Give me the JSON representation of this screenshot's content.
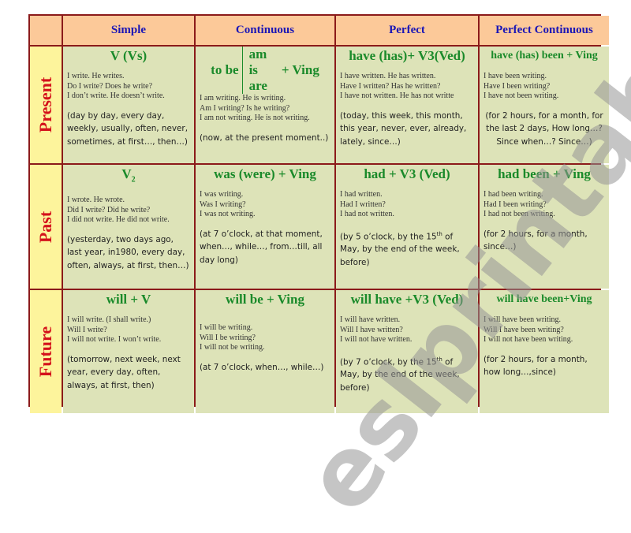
{
  "headers": [
    "Simple",
    "Continuous",
    "Perfect",
    "Perfect Continuous"
  ],
  "rows": [
    {
      "label": "Present",
      "cells": [
        {
          "formula": "V (Vs)",
          "examples": "I write. He writes.\nDo I write? Does he write?\nI don’t write. He doesn’t write.",
          "markers": "(day by day, every day, weekly, usually, often, never, sometimes, at first…, then…)"
        },
        {
          "formula_prefix": "to be",
          "formula_options": [
            "am",
            "is",
            "are"
          ],
          "formula_suffix": "+ Ving",
          "examples": "I am writing. He is writing.\nAm I writing? Is he writing?\nI am not writing. He is not writing.",
          "markers": "(now, at the present moment..)"
        },
        {
          "formula": "have (has)+ V3(Ved)",
          "examples": "I have written. He has written.\nHave I written? Has he written?\nI have not written. He has not writte",
          "markers": "(today, this week, this month, this year, never, ever, already, lately, since…)"
        },
        {
          "formula": "have (has) been + Ving",
          "examples": "I have been writing.\n  Have I been writing?\n  I have not been writing.",
          "markers": "(for 2 hours, for a month, for the last 2 days, How long…? Since when…? Since…)"
        }
      ]
    },
    {
      "label": "Past",
      "cells": [
        {
          "formula": "V2",
          "examples": "I wrote. He wrote.\nDid I write? Did he write?\nI did not write. He did not write.",
          "markers": "(yesterday, two days ago, last year, in1980, every day, often, always, at first, then…)"
        },
        {
          "formula": "was (were) + Ving",
          "examples": "I was writing.\nWas I writing?\nI was not writing.",
          "markers": "(at 7 o’clock, at that moment, when…, while…, from…till, all day long)"
        },
        {
          "formula": "had + V3 (Ved)",
          "examples": "I had written.\nHad I written?\nI had not written.",
          "markers_pre": "(by 5 o’clock, by the 15",
          "markers_sup": "th",
          "markers_post": " of May, by the end of the week, before)"
        },
        {
          "formula": "had been + Ving",
          "examples": "I had been writing.\nHad I been writing?\nI had not been writing.",
          "markers": "(for 2 hours, for a month, since…)"
        }
      ]
    },
    {
      "label": "Future",
      "cells": [
        {
          "formula": "will + V",
          "examples": "I will write. (I shall write.)\nWill I write?\nI will not write. I won’t write.",
          "markers": "(tomorrow, next week, next year, every day, often, always, at first, then)"
        },
        {
          "formula": "will be + Ving",
          "examples": "I will be writing.\nWill I be writing?\nI will not be writing.",
          "markers": "(at 7 o’clock, when…, while…)"
        },
        {
          "formula": "will have +V3 (Ved)",
          "examples": "I will have written.\nWill I have written?\nI will not have written.",
          "markers_pre": "(by 7 o’clock, by the 15",
          "markers_sup": "th",
          "markers_post": " of May, by the end of the week, before)"
        },
        {
          "formula": "will have been+Ving",
          "examples": "I will have been writing.\nWill I have been writing?\nI will not have been writing.",
          "markers": "(for 2 hours, for a month, how long…,since)"
        }
      ]
    }
  ],
  "watermark": "eslprintables.com",
  "colors": {
    "border": "#8b1a1a",
    "header_bg": "#fcc999",
    "header_text": "#1b16b6",
    "side_bg": "#fdf49c",
    "side_text": "#d4121b",
    "cell_bg": "#dde3b8",
    "formula_text": "#1a8a2a"
  }
}
